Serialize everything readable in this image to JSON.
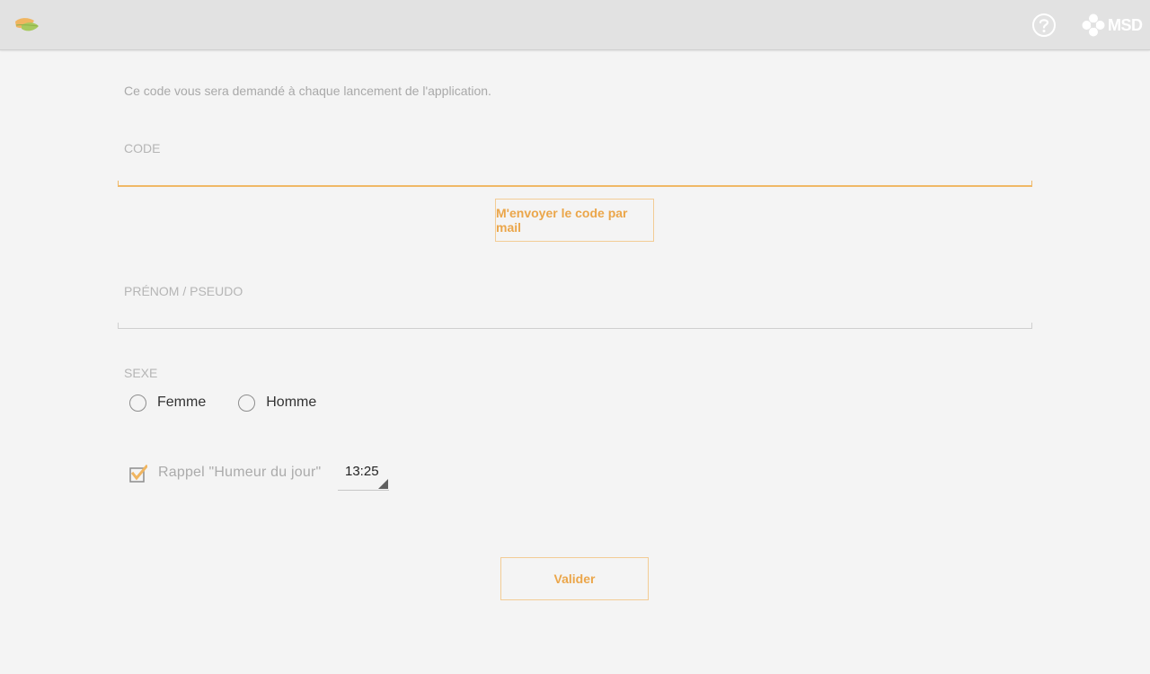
{
  "header": {
    "logo_icon": "leaf-logo-icon",
    "help_icon": "question-circle-icon",
    "brand": "MSD"
  },
  "form": {
    "intro": "Ce code vous sera demandé à chaque lancement de l'application.",
    "code_label": "CODE",
    "code_value": "",
    "send_code_button": "M'envoyer le code par mail",
    "name_label": "PRÉNOM / PSEUDO",
    "name_value": "",
    "sex_label": "SEXE",
    "sex_options": [
      "Femme",
      "Homme"
    ],
    "reminder_label": "Rappel \"Humeur du jour\"",
    "reminder_checked": true,
    "reminder_time": "13:25",
    "submit_button": "Valider"
  },
  "colors": {
    "accent": "#eba64a",
    "accent_border": "#f3cc95",
    "topbar": "#e2e2e2",
    "background": "#f4f4f4"
  }
}
